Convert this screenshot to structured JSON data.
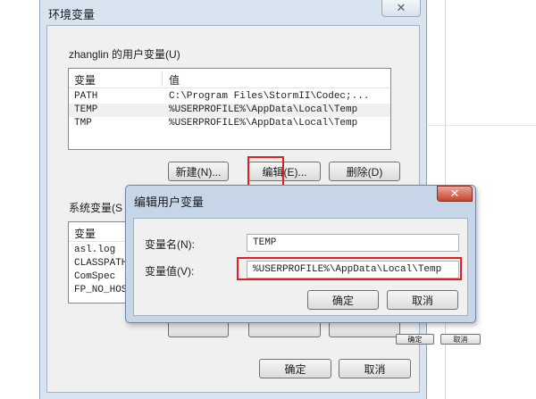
{
  "window": {
    "title": "环境变量",
    "close_glyph": "✕"
  },
  "user_section": {
    "label": "zhanglin 的用户变量(U)",
    "columns": [
      "变量",
      "值"
    ],
    "rows": [
      {
        "name": "PATH",
        "value": "C:\\Program Files\\StormII\\Codec;..."
      },
      {
        "name": "TEMP",
        "value": "%USERPROFILE%\\AppData\\Local\\Temp"
      },
      {
        "name": "TMP",
        "value": "%USERPROFILE%\\AppData\\Local\\Temp"
      }
    ],
    "buttons": {
      "new": "新建(N)...",
      "edit": "编辑(E)...",
      "delete": "删除(D)"
    }
  },
  "system_section": {
    "label": "系统变量(S",
    "column": "变量",
    "rows": [
      "asl.log",
      "CLASSPATH",
      "ComSpec",
      "FP_NO_HOS"
    ]
  },
  "main_buttons": {
    "ok": "确定",
    "cancel": "取消"
  },
  "dialog": {
    "title": "编辑用户变量",
    "close_glyph": "✕",
    "name_label": "变量名(N):",
    "name_value": "TEMP",
    "value_label": "变量值(V):",
    "value_value": "%USERPROFILE%\\AppData\\Local\\Temp",
    "ok": "确定",
    "cancel": "取消"
  },
  "thumb_buttons": {
    "ok": "确定",
    "cancel": "取消"
  },
  "colors": {
    "highlight": "#e02020",
    "window_frame": "#d9e4f1",
    "dialog_frame": "#c6d5e7",
    "close_red": "#c7432b"
  }
}
